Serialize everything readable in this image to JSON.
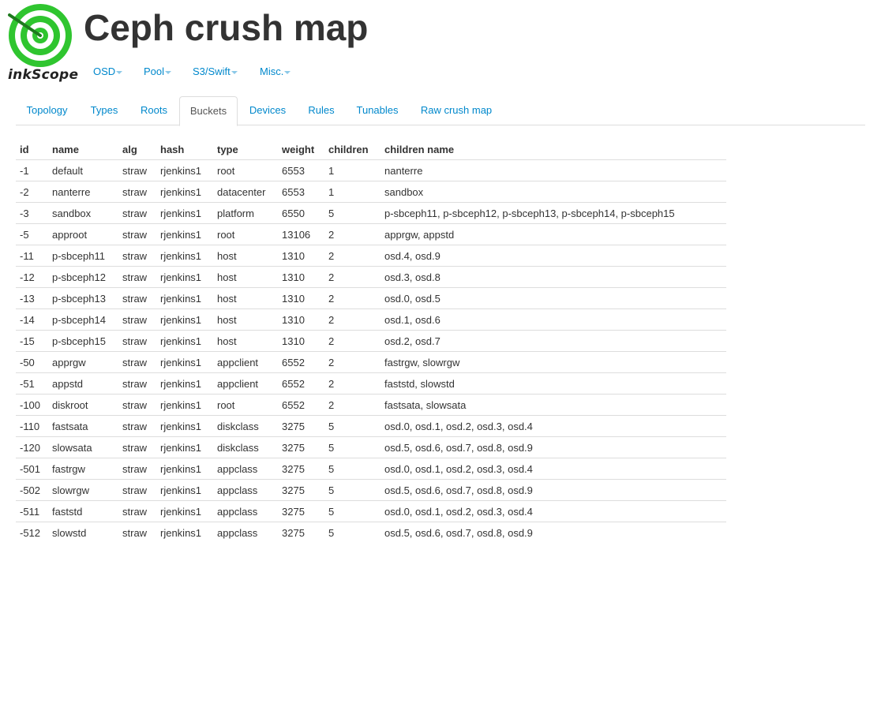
{
  "logo": {
    "text": "inkScope"
  },
  "page_title": "Ceph crush map",
  "colors": {
    "link": "#0088cc",
    "logo_green": "#2fc52f",
    "text": "#333333"
  },
  "menu": [
    {
      "label": "OSD",
      "icon": "caret-down-icon"
    },
    {
      "label": "Pool",
      "icon": "caret-down-icon"
    },
    {
      "label": "S3/Swift",
      "icon": "caret-down-icon"
    },
    {
      "label": "Misc.",
      "icon": "caret-down-icon"
    }
  ],
  "tabs": [
    {
      "label": "Topology",
      "active": false
    },
    {
      "label": "Types",
      "active": false
    },
    {
      "label": "Roots",
      "active": false
    },
    {
      "label": "Buckets",
      "active": true
    },
    {
      "label": "Devices",
      "active": false
    },
    {
      "label": "Rules",
      "active": false
    },
    {
      "label": "Tunables",
      "active": false
    },
    {
      "label": "Raw crush map",
      "active": false
    }
  ],
  "table": {
    "columns": [
      "id",
      "name",
      "alg",
      "hash",
      "type",
      "weight",
      "children",
      "children name"
    ],
    "rows": [
      [
        "-1",
        "default",
        "straw",
        "rjenkins1",
        "root",
        "6553",
        "1",
        "nanterre"
      ],
      [
        "-2",
        "nanterre",
        "straw",
        "rjenkins1",
        "datacenter",
        "6553",
        "1",
        "sandbox"
      ],
      [
        "-3",
        "sandbox",
        "straw",
        "rjenkins1",
        "platform",
        "6550",
        "5",
        "p-sbceph11, p-sbceph12, p-sbceph13, p-sbceph14, p-sbceph15"
      ],
      [
        "-5",
        "approot",
        "straw",
        "rjenkins1",
        "root",
        "13106",
        "2",
        "apprgw, appstd"
      ],
      [
        "-11",
        "p-sbceph11",
        "straw",
        "rjenkins1",
        "host",
        "1310",
        "2",
        "osd.4, osd.9"
      ],
      [
        "-12",
        "p-sbceph12",
        "straw",
        "rjenkins1",
        "host",
        "1310",
        "2",
        "osd.3, osd.8"
      ],
      [
        "-13",
        "p-sbceph13",
        "straw",
        "rjenkins1",
        "host",
        "1310",
        "2",
        "osd.0, osd.5"
      ],
      [
        "-14",
        "p-sbceph14",
        "straw",
        "rjenkins1",
        "host",
        "1310",
        "2",
        "osd.1, osd.6"
      ],
      [
        "-15",
        "p-sbceph15",
        "straw",
        "rjenkins1",
        "host",
        "1310",
        "2",
        "osd.2, osd.7"
      ],
      [
        "-50",
        "apprgw",
        "straw",
        "rjenkins1",
        "appclient",
        "6552",
        "2",
        "fastrgw, slowrgw"
      ],
      [
        "-51",
        "appstd",
        "straw",
        "rjenkins1",
        "appclient",
        "6552",
        "2",
        "faststd, slowstd"
      ],
      [
        "-100",
        "diskroot",
        "straw",
        "rjenkins1",
        "root",
        "6552",
        "2",
        "fastsata, slowsata"
      ],
      [
        "-110",
        "fastsata",
        "straw",
        "rjenkins1",
        "diskclass",
        "3275",
        "5",
        "osd.0, osd.1, osd.2, osd.3, osd.4"
      ],
      [
        "-120",
        "slowsata",
        "straw",
        "rjenkins1",
        "diskclass",
        "3275",
        "5",
        "osd.5, osd.6, osd.7, osd.8, osd.9"
      ],
      [
        "-501",
        "fastrgw",
        "straw",
        "rjenkins1",
        "appclass",
        "3275",
        "5",
        "osd.0, osd.1, osd.2, osd.3, osd.4"
      ],
      [
        "-502",
        "slowrgw",
        "straw",
        "rjenkins1",
        "appclass",
        "3275",
        "5",
        "osd.5, osd.6, osd.7, osd.8, osd.9"
      ],
      [
        "-511",
        "faststd",
        "straw",
        "rjenkins1",
        "appclass",
        "3275",
        "5",
        "osd.0, osd.1, osd.2, osd.3, osd.4"
      ],
      [
        "-512",
        "slowstd",
        "straw",
        "rjenkins1",
        "appclass",
        "3275",
        "5",
        "osd.5, osd.6, osd.7, osd.8, osd.9"
      ]
    ]
  }
}
